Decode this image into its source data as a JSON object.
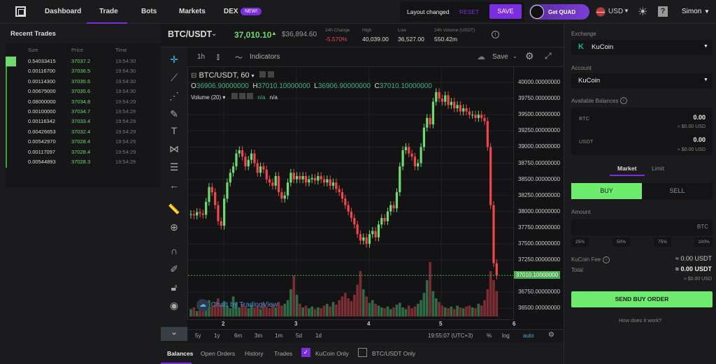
{
  "nav": {
    "items": [
      "Dashboard",
      "Trade",
      "Bots",
      "Markets",
      "DEX"
    ],
    "new_badge": "NEW!",
    "layout_changed": "Layout changed",
    "reset": "RESET",
    "save": "SAVE",
    "get_quad": "Get QUAD",
    "currency": "USD",
    "user": "Simon",
    "accent": "#7b2ee0"
  },
  "recent_trades": {
    "title": "Recent Trades",
    "headers": [
      "Size",
      "Price",
      "Time"
    ],
    "rows": [
      [
        "0.54033415",
        "37037.2",
        "19:54:30"
      ],
      [
        "0.00116700",
        "37036.5",
        "19:54:30"
      ],
      [
        "0.00114300",
        "37035.6",
        "19:54:30"
      ],
      [
        "0.00675000",
        "37035.6",
        "19:54:30"
      ],
      [
        "0.08000000",
        "37034.8",
        "19:54:29"
      ],
      [
        "0.00100000",
        "37034.7",
        "19:54:29"
      ],
      [
        "0.00116342",
        "37033.4",
        "19:54:29"
      ],
      [
        "0.00426653",
        "37032.4",
        "19:54:29"
      ],
      [
        "0.00542970",
        "37028.4",
        "19:54:29"
      ],
      [
        "0.00117097",
        "37028.4",
        "19:54:29"
      ],
      [
        "0.00544893",
        "37028.3",
        "19:54:29"
      ]
    ]
  },
  "ticker": {
    "pair": "BTC/USDT",
    "price": "37,010.10",
    "usd_price": "$36,894.60",
    "stats": [
      {
        "label": "24h Change",
        "value": "-5.570%"
      },
      {
        "label": "High",
        "value": "40,039.00"
      },
      {
        "label": "Low",
        "value": "36,527.00"
      },
      {
        "label": "24h Volume (USDT)",
        "value": "550.42m"
      }
    ]
  },
  "toolbar": {
    "interval": "1h",
    "indicators": "Indicators",
    "save": "Save"
  },
  "legend": {
    "title": "BTC/USDT, 60",
    "o_label": "O",
    "o": "36906.90000000",
    "h_label": "H",
    "h": "37010.10000000",
    "l_label": "L",
    "l": "36906.90000000",
    "c_label": "C",
    "c": "37010.10000000",
    "volume": "Volume (20)",
    "na1": "n/a",
    "na2": "n/a",
    "watermark": "Chart by TradingView"
  },
  "chart_data": {
    "type": "candlestick",
    "symbol": "BTC/USDT",
    "interval": "60",
    "ylim": [
      36400,
      40100
    ],
    "yticks": [
      "40000.00000000",
      "39750.00000000",
      "39500.00000000",
      "39250.00000000",
      "39000.00000000",
      "38750.00000000",
      "38500.00000000",
      "38250.00000000",
      "38000.00000000",
      "37750.00000000",
      "37500.00000000",
      "37250.00000000",
      "36750.00000000",
      "36500.00000000"
    ],
    "ytick_values": [
      40000,
      39750,
      39500,
      39250,
      39000,
      38750,
      38500,
      38250,
      38000,
      37750,
      37500,
      37250,
      36750,
      36500
    ],
    "xticks": [
      "2",
      "3",
      "4",
      "5",
      "6"
    ],
    "last_price_label": "37010.10000000",
    "last_price": 37010.1,
    "up_color": "#6ddb6d",
    "down_color": "#f0474c",
    "first_open": 37950,
    "closes": [
      37960,
      37940,
      37990,
      37970,
      37950,
      38150,
      38380,
      38300,
      38100,
      37850,
      37780,
      38200,
      38450,
      38600,
      38700,
      38900,
      38950,
      38850,
      38700,
      38800,
      38900,
      38750,
      38600,
      38700,
      38650,
      38500,
      38450,
      38400,
      38550,
      38300,
      38200,
      38250,
      38450,
      38600,
      38500,
      38550,
      38500,
      38550,
      38450,
      38500,
      38520,
      38480,
      38550,
      38500,
      38450,
      38500,
      38400,
      38450,
      38350,
      38300,
      38200,
      38100,
      38000,
      37900,
      37800,
      37650,
      37550,
      37600,
      37500,
      37650,
      37700,
      37600,
      37800,
      37900,
      37850,
      38000,
      38100,
      38050,
      38300,
      38700,
      38950,
      39000,
      38900,
      38850,
      38700,
      38750,
      39000,
      39300,
      39450,
      39350,
      39700,
      39850,
      39750,
      39700,
      39800,
      39650,
      39700,
      39600,
      39650,
      39550,
      39600,
      39550,
      39500,
      39500,
      39450,
      39500,
      39450,
      39400,
      39000,
      38100,
      37200,
      37010
    ],
    "volumes": [
      8,
      10,
      6,
      12,
      9,
      14,
      18,
      11,
      15,
      20,
      13,
      17,
      12,
      9,
      22,
      16,
      10,
      14,
      11,
      9,
      13,
      10,
      12,
      8,
      15,
      11,
      9,
      13,
      10,
      16,
      12,
      14,
      18,
      30,
      45,
      24,
      14,
      10,
      12,
      9,
      11,
      8,
      10,
      9,
      12,
      14,
      11,
      16,
      13,
      18,
      22,
      26,
      20,
      17,
      24,
      35,
      50,
      30,
      22,
      15,
      18,
      14,
      12,
      10,
      9,
      11,
      8,
      10,
      13,
      15,
      10,
      8,
      12,
      9,
      11,
      14,
      18,
      26,
      40,
      60,
      28,
      20,
      16,
      12,
      10,
      9,
      11,
      8,
      12,
      10,
      9,
      11,
      12,
      10,
      9,
      14,
      12,
      18,
      30,
      50,
      40,
      28
    ]
  },
  "timeaxis": {
    "clock": "19:55:07 (UTC+3)",
    "ranges": [
      "5y",
      "1y",
      "6m",
      "3m",
      "1m",
      "5d",
      "1d"
    ],
    "pct": "%",
    "log": "log",
    "auto": "auto"
  },
  "bottom_tabs": {
    "tabs": [
      "Balances",
      "Open Orders",
      "History",
      "Trades"
    ],
    "kucoin_only": "KuCoin Only",
    "pair_only": "BTC/USDT Only"
  },
  "order": {
    "exchange_label": "Exchange",
    "exchange": "KuCoin",
    "account_label": "Account",
    "account": "KuCoin",
    "balances_label": "Available Balances",
    "balances": [
      {
        "asset": "BTC",
        "amount": "0.00",
        "usd": "≈ $0.00 USD"
      },
      {
        "asset": "USDT",
        "amount": "0.00",
        "usd": "≈ $0.00 USD"
      }
    ],
    "tabs": [
      "Market",
      "Limit"
    ],
    "buy": "BUY",
    "sell": "SELL",
    "amount_label": "Amount",
    "amount_unit": "BTC",
    "amount_value": "",
    "pcts": [
      "25%",
      "50%",
      "75%",
      "100%"
    ],
    "fee_label": "KuCoin Fee",
    "fee": "≈ 0.00 USDT",
    "total_label": "Total",
    "total": "≈ 0.00 USDT",
    "total_usd": "≈ $0.00 USD",
    "send": "SEND BUY ORDER",
    "help": "How does it work?"
  }
}
